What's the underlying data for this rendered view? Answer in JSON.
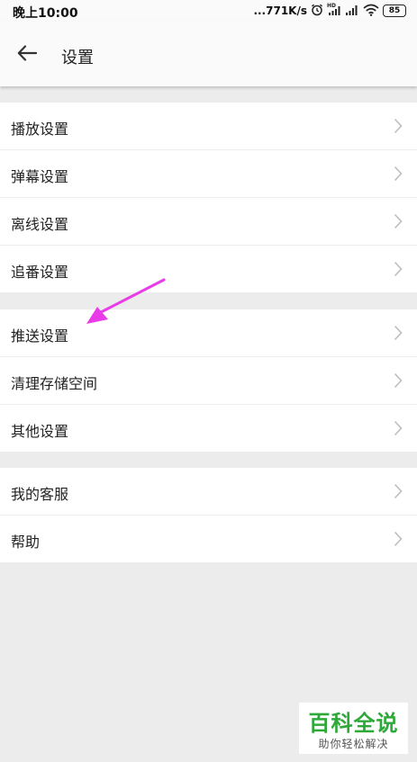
{
  "status_bar": {
    "time": "晚上10:00",
    "net_speed": "...771K/s",
    "battery": "85",
    "icons": [
      "alarm-icon",
      "hd-signal-icon",
      "signal-icon",
      "wifi-icon",
      "battery-icon"
    ]
  },
  "header": {
    "back_icon": "back-arrow-icon",
    "title": "设置"
  },
  "groups": [
    {
      "items": [
        {
          "label": "播放设置",
          "icon": "chevron-right-icon"
        },
        {
          "label": "弹幕设置",
          "icon": "chevron-right-icon"
        },
        {
          "label": "离线设置",
          "icon": "chevron-right-icon"
        },
        {
          "label": "追番设置",
          "icon": "chevron-right-icon"
        }
      ]
    },
    {
      "items": [
        {
          "label": "推送设置",
          "icon": "chevron-right-icon"
        },
        {
          "label": "清理存储空间",
          "icon": "chevron-right-icon"
        },
        {
          "label": "其他设置",
          "icon": "chevron-right-icon"
        }
      ]
    },
    {
      "items": [
        {
          "label": "我的客服",
          "icon": "chevron-right-icon"
        },
        {
          "label": "帮助",
          "icon": "chevron-right-icon"
        }
      ]
    }
  ],
  "annotation": {
    "type": "arrow",
    "color": "#e83ce8",
    "points_to": "推送设置"
  },
  "watermark": {
    "main": "百科全说",
    "sub": "助你轻松解决",
    "color": "#2fa83a"
  },
  "colors": {
    "background": "#ececec",
    "panel": "#ffffff",
    "text": "#222222",
    "chevron": "#bdbdbd"
  }
}
